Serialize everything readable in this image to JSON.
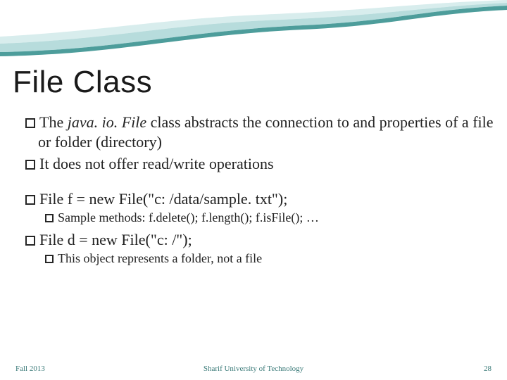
{
  "title": "File Class",
  "bullets": {
    "b1a_pre": "The ",
    "b1a_italic": "java. io. File",
    "b1a_post": " class abstracts the connection to and properties of a file or folder (directory)",
    "b1b": "It does not offer read/write operations",
    "b1c": "File f = new File(\"c: /data/sample. txt\");",
    "b2c": "Sample methods: f.delete(); f.length(); f.isFile(); …",
    "b1d": "File d = new File(\"c: /\");",
    "b2d": "This object represents a folder, not a file"
  },
  "footer": {
    "left": "Fall 2013",
    "center": "Sharif University of Technology",
    "right": "28"
  }
}
